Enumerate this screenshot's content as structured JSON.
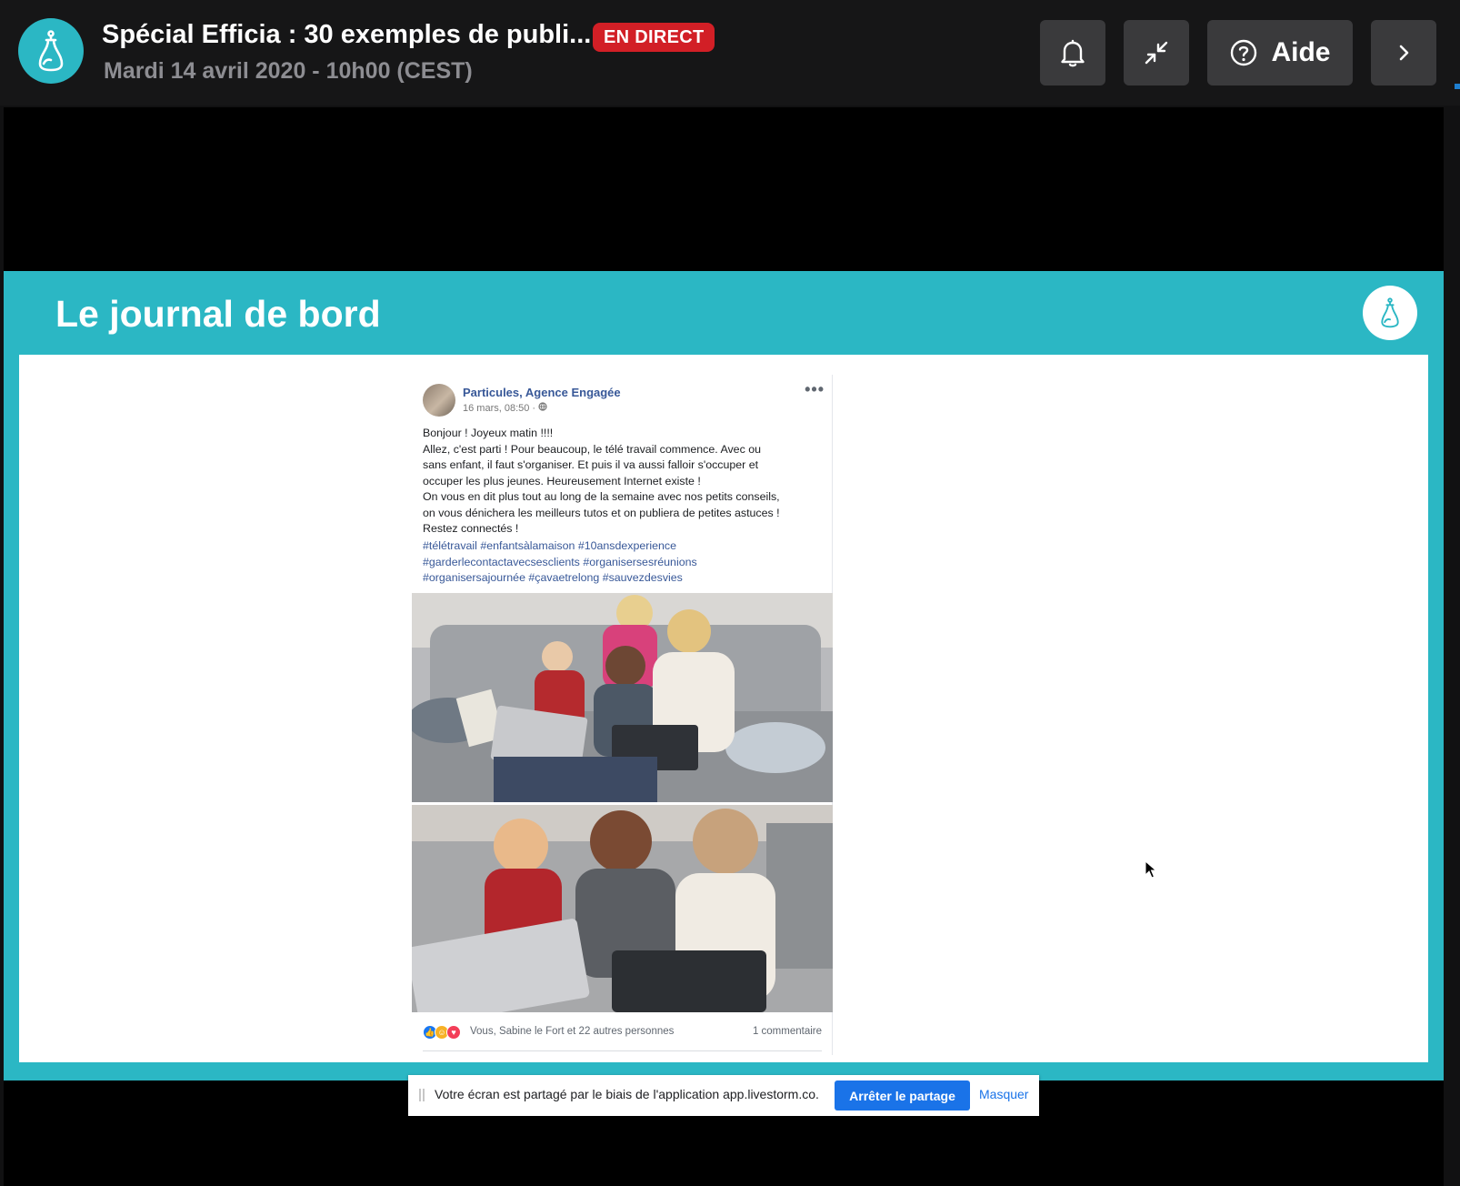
{
  "header": {
    "title": "Spécial Efficia : 30 exemples de publi...",
    "live_badge": "EN DIRECT",
    "subtitle": "Mardi 14 avril 2020 - 10h00 (CEST)",
    "help_label": "Aide",
    "icons": [
      "bell-icon",
      "collapse-icon",
      "help-circle-icon",
      "chevron-right-icon"
    ],
    "colors": {
      "brand": "#2bb7c4",
      "live": "#d21f26",
      "button_bg": "#3a3a3c"
    }
  },
  "slide": {
    "title": "Le journal de bord",
    "background": "#2bb7c4"
  },
  "post": {
    "author": "Particules, Agence Engagée",
    "meta": "16 mars, 08:50 · ",
    "more": "•••",
    "lines": [
      "Bonjour ! Joyeux matin !!!!",
      "Allez, c'est parti ! Pour beaucoup, le télé travail commence. Avec ou",
      "sans enfant, il faut s'organiser. Et puis il va aussi falloir s'occuper et",
      "occuper les plus jeunes. Heureusement Internet existe !",
      "On vous en dit plus tout au long de la semaine avec nos petits conseils,",
      "on vous dénichera les meilleurs tutos et on publiera de petites astuces !",
      "Restez connectés !"
    ],
    "hashtags": [
      "#télétravail #enfantsàlamaison #10ansdexperience",
      "#garderlecontactavecsesclients #organisersesréunions",
      "#organisersajournée #çavaetrelong #sauvezdesvies"
    ],
    "reactions_text": "Vous, Sabine le Fort et 22 autres personnes",
    "comments_text": "1 commentaire"
  },
  "sharebar": {
    "message": "Votre écran est partagé par le biais de l'application app.livestorm.co.",
    "stop_label": "Arrêter le partage",
    "hide_label": "Masquer"
  }
}
